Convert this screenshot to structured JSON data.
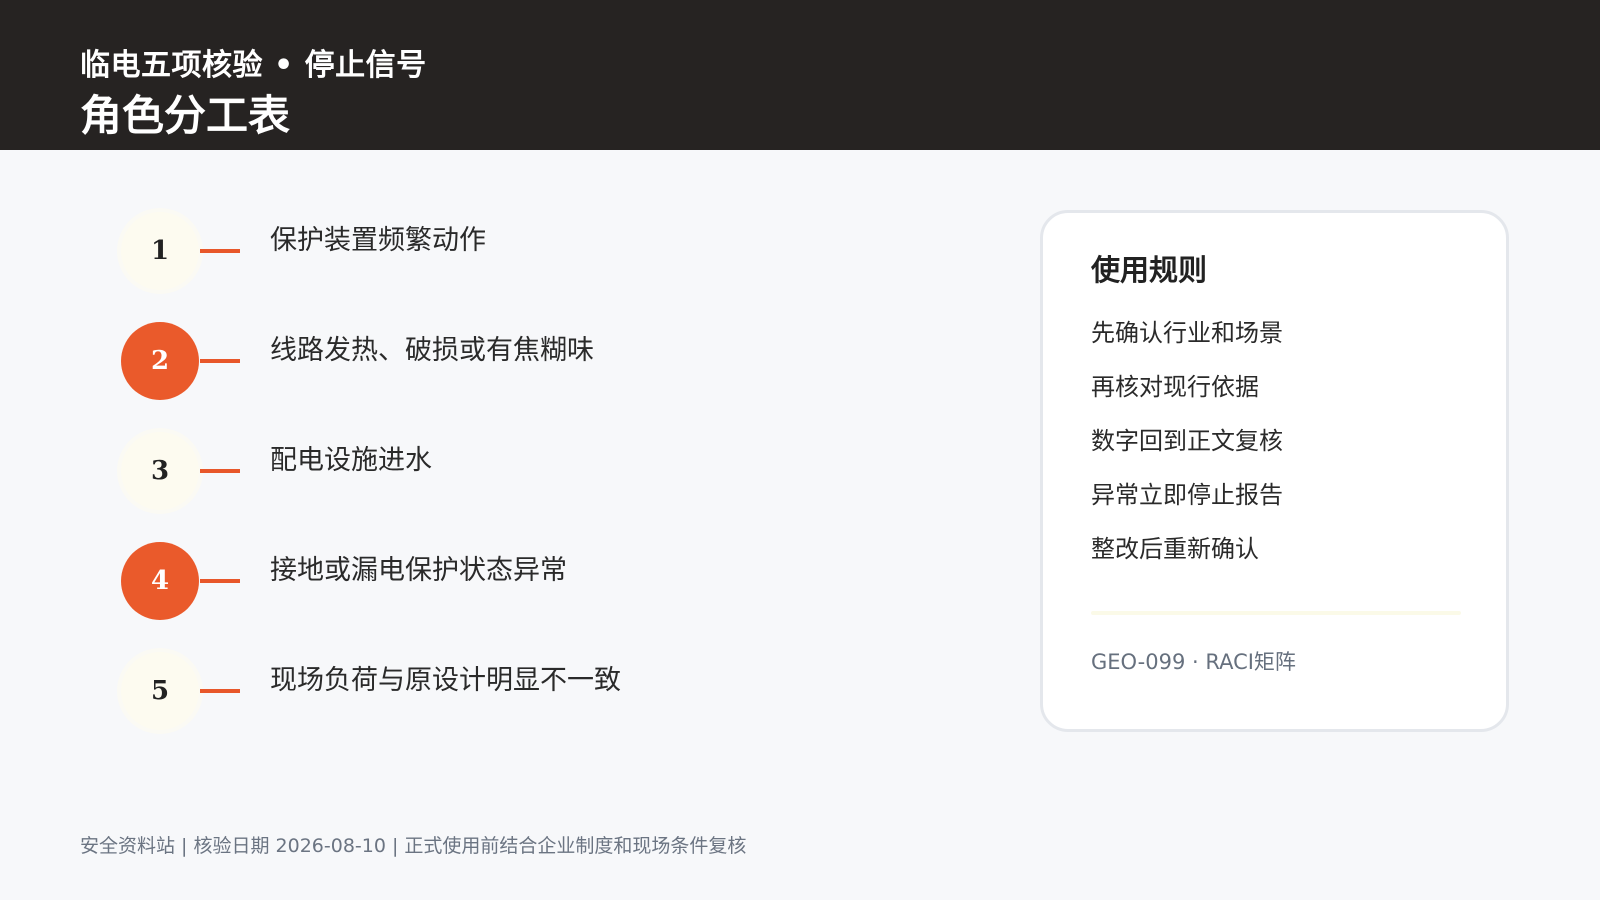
{
  "header": {
    "subtitle": "临电五项核验 • 停止信号",
    "title": "角色分工表"
  },
  "steps": [
    {
      "number": "1",
      "text": "保护装置频繁动作",
      "style": "light"
    },
    {
      "number": "2",
      "text": "线路发热、破损或有焦糊味",
      "style": "accent"
    },
    {
      "number": "3",
      "text": "配电设施进水",
      "style": "light"
    },
    {
      "number": "4",
      "text": "接地或漏电保护状态异常",
      "style": "accent"
    },
    {
      "number": "5",
      "text": "现场负荷与原设计明显不一致",
      "style": "light"
    }
  ],
  "card": {
    "title": "使用规则",
    "items": [
      "先确认行业和场景",
      "再核对现行依据",
      "数字回到正文复核",
      "异常立即停止报告",
      "整改后重新确认"
    ],
    "footnote": "GEO-099 · RACI矩阵"
  },
  "footer": {
    "text": "安全资料站 | 核验日期 2026-08-10 | 正式使用前结合企业制度和现场条件复核"
  },
  "colors": {
    "header_bg": "#262322",
    "accent": "#ea5a2b",
    "light_circle": "#fdfbf0",
    "page_bg": "#f7f8fa"
  }
}
